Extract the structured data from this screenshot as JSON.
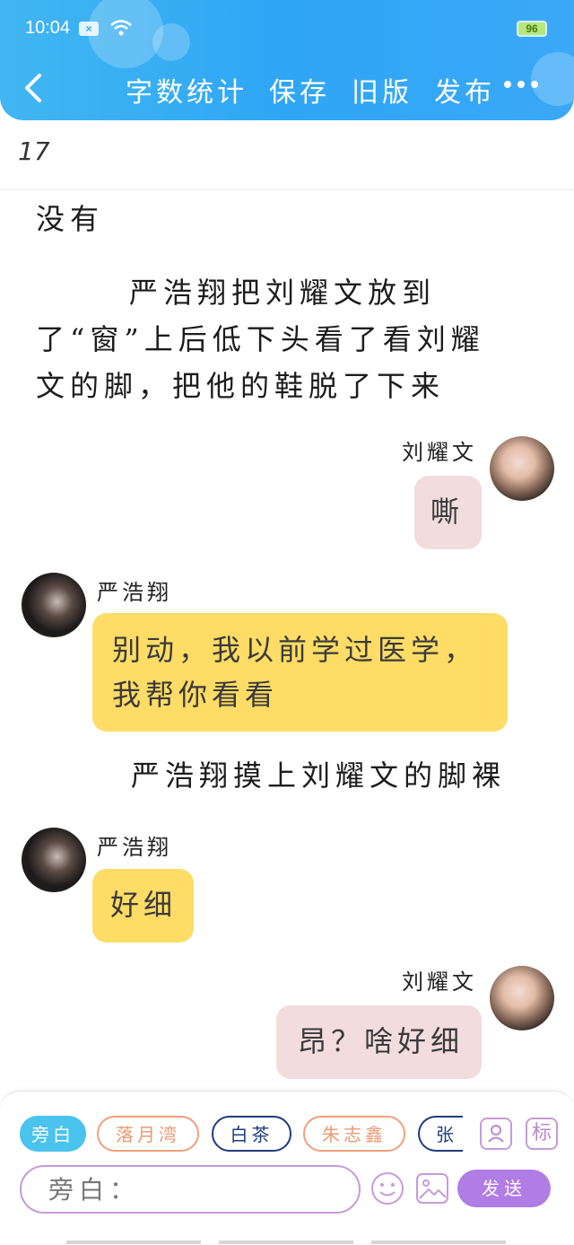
{
  "status": {
    "time": "10:04",
    "battery": "96"
  },
  "header": {
    "back_icon": "chevron-left-icon",
    "nav": [
      "字数统计",
      "保存",
      "旧版",
      "发布"
    ],
    "more_icon": "more-dots-icon"
  },
  "word_count": "17",
  "chat": {
    "narration1": "没有",
    "narration2_line1": "严浩翔把刘耀文放到",
    "narration2_line2": "了“窗”上后低下头看了看刘耀",
    "narration2_line3": "文的脚，把他的鞋脱了下来",
    "m1": {
      "speaker": "刘耀文",
      "text": "嘶"
    },
    "m2": {
      "speaker": "严浩翔",
      "line1": "别动，我以前学过医学，",
      "line2": "我帮你看看"
    },
    "narration3": "严浩翔摸上刘耀文的脚裸",
    "m3": {
      "speaker": "严浩翔",
      "text": "好细"
    },
    "m4": {
      "speaker": "刘耀文",
      "text": "昂？啥好细"
    }
  },
  "composer": {
    "roles": [
      "旁白",
      "落月湾",
      "白茶",
      "朱志鑫",
      "张"
    ],
    "role_tool_icon": "user-card-icon",
    "tag_tool_label": "标",
    "input_placeholder": "旁白：",
    "emoji_icon": "emoji-icon",
    "image_icon": "image-icon",
    "send_label": "发送"
  },
  "colors": {
    "header_blue": "#2fa6f4",
    "bubble_pink": "#f2dcdd",
    "bubble_yellow": "#fedc65",
    "accent_purple": "#b07de4",
    "chip_active": "#4ac3ee",
    "chip_orange": "#f0a07a",
    "chip_navy": "#1f3d7a"
  }
}
